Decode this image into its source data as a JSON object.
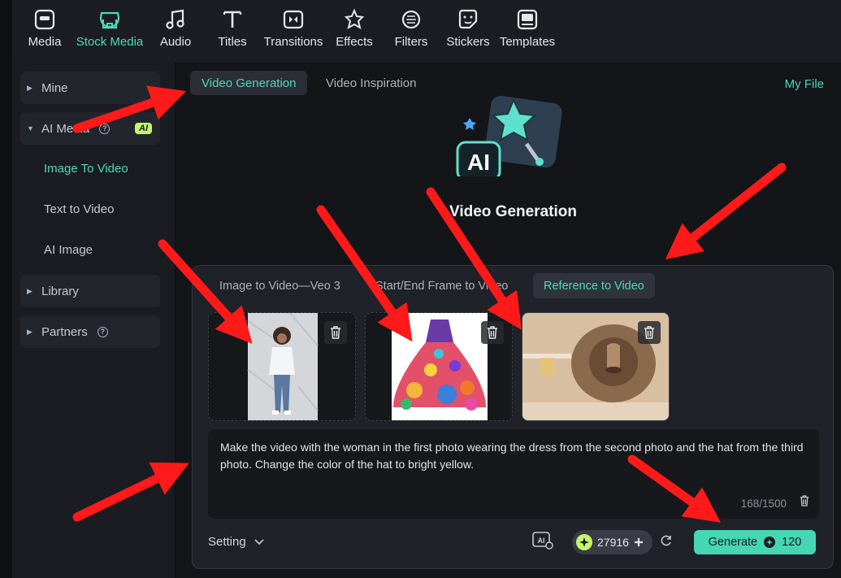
{
  "toolbar": {
    "items": [
      {
        "label": "Media",
        "icon": "media-icon"
      },
      {
        "label": "Stock Media",
        "icon": "store-icon"
      },
      {
        "label": "Audio",
        "icon": "music-note-icon"
      },
      {
        "label": "Titles",
        "icon": "text-t-icon"
      },
      {
        "label": "Transitions",
        "icon": "transition-icon"
      },
      {
        "label": "Effects",
        "icon": "sparkle-icon"
      },
      {
        "label": "Filters",
        "icon": "filter-icon"
      },
      {
        "label": "Stickers",
        "icon": "sticker-icon"
      },
      {
        "label": "Templates",
        "icon": "template-icon"
      }
    ],
    "active": "Stock Media"
  },
  "sidebar": {
    "mine": "Mine",
    "ai_media": "AI Media",
    "ai_badge": "AI",
    "items": [
      "Image To Video",
      "Text to Video",
      "AI Image"
    ],
    "library": "Library",
    "partners": "Partners"
  },
  "main": {
    "tabs": [
      "Video Generation",
      "Video Inspiration"
    ],
    "my_file": "My File",
    "hero_title": "Video Generation",
    "hero_logo_text": "AI"
  },
  "panel": {
    "tabs": [
      "Image to Video—Veo 3",
      "Start/End Frame to Video",
      "Reference to Video"
    ],
    "active_tab": "Reference to Video",
    "thumbnails": [
      {
        "name": "woman-photo"
      },
      {
        "name": "dress-photo"
      },
      {
        "name": "hat-photo"
      }
    ],
    "prompt": "Make the video with the woman in the first photo wearing the dress from the second photo and the hat from the third photo. Change the color of the hat to bright yellow.",
    "counter": "168/1500",
    "setting": "Setting",
    "credits": "27916",
    "generate": "Generate",
    "generate_cost": "120"
  },
  "colors": {
    "accent": "#4fd8b8",
    "generate_bg": "#46d6b3",
    "ai_badge": "#c6f56a",
    "annotation_arrow": "#ff1a1a"
  }
}
